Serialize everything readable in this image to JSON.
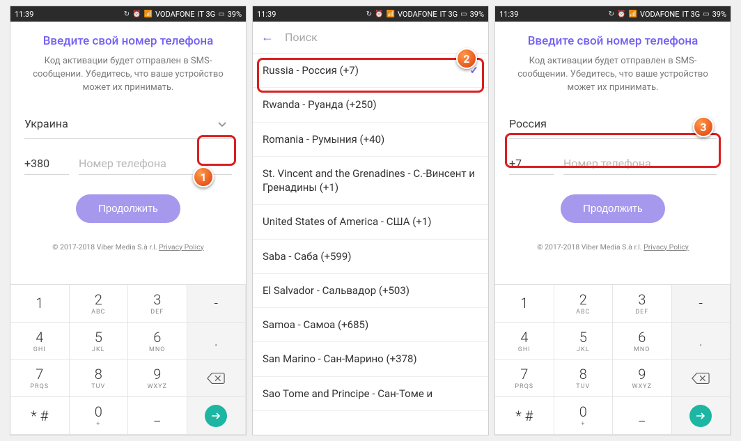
{
  "status": {
    "time": "11:39",
    "carrier": "VODAFONE",
    "net": "IT 3G",
    "batt": "39%"
  },
  "viber": {
    "title": "Введите свой номер телефона",
    "subtitle": "Код активации будет отправлен в SMS-сообщении. Убедитесь, что ваше устройство может их принимать.",
    "phone_placeholder": "Номер телефона",
    "continue": "Продолжить",
    "footer_copy": "© 2017-2018 Viber Media S.à r.l. ",
    "footer_pp": "Privacy Policy"
  },
  "screen1": {
    "country": "Украина",
    "code": "+380"
  },
  "screen3": {
    "country": "Россия",
    "code": "+7"
  },
  "search": {
    "placeholder": "Поиск",
    "items": [
      "Russia - Россия (+7)",
      "Rwanda - Руанда (+250)",
      "Romania - Румыния (+40)",
      "St. Vincent and the Grenadines - С.-Винсент и Гренадины (+1)",
      "United States of America - США (+1)",
      "Saba - Саба (+599)",
      "El Salvador - Сальвадор (+503)",
      "Samoa - Самоа (+685)",
      "San Marino - Сан-Марино (+378)",
      "Sao Tome and Principe - Сан-Томе и"
    ]
  },
  "keypad": {
    "rows": [
      [
        {
          "d": "1",
          "l": ""
        },
        {
          "d": "2",
          "l": "ABC"
        },
        {
          "d": "3",
          "l": "DEF"
        },
        {
          "d": "-",
          "l": ""
        }
      ],
      [
        {
          "d": "4",
          "l": "GHI"
        },
        {
          "d": "5",
          "l": "JKL"
        },
        {
          "d": "6",
          "l": "MNO"
        },
        {
          "d": ".",
          "l": ""
        }
      ],
      [
        {
          "d": "7",
          "l": "PRQS"
        },
        {
          "d": "8",
          "l": "TUV"
        },
        {
          "d": "9",
          "l": "WXYZ"
        },
        {
          "d": "BKSP",
          "l": ""
        }
      ],
      [
        {
          "d": "* #",
          "l": ""
        },
        {
          "d": "0",
          "l": "+"
        },
        {
          "d": "_",
          "l": ""
        },
        {
          "d": "GO",
          "l": ""
        }
      ]
    ]
  },
  "badges": {
    "b1": "1",
    "b2": "2",
    "b3": "3"
  }
}
